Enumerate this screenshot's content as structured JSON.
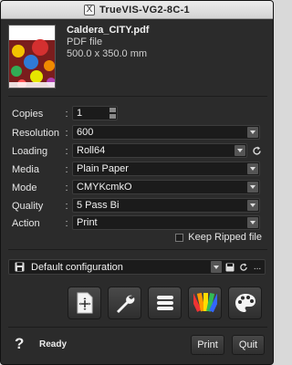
{
  "window": {
    "title": "TrueVIS-VG2-8C-1"
  },
  "file": {
    "name": "Caldera_CITY.pdf",
    "type": "PDF file",
    "size": "500.0 x 350.0 mm"
  },
  "settings": {
    "copies": {
      "label": "Copies",
      "value": "1"
    },
    "resolution": {
      "label": "Resolution",
      "value": "600"
    },
    "loading": {
      "label": "Loading",
      "value": "Roll64"
    },
    "media": {
      "label": "Media",
      "value": "Plain Paper"
    },
    "mode": {
      "label": "Mode",
      "value": "CMYKcmkO"
    },
    "quality": {
      "label": "Quality",
      "value": "5 Pass Bi"
    },
    "action": {
      "label": "Action",
      "value": "Print"
    },
    "colon": ":"
  },
  "keep_ripped": {
    "label": "Keep Ripped file",
    "checked": false
  },
  "configuration": {
    "value": "Default configuration",
    "more": "..."
  },
  "toolbar_icons": [
    "add-page-icon",
    "wrench-icon",
    "list-icon",
    "color-swatch-icon",
    "palette-icon"
  ],
  "status": {
    "help": "?",
    "text": "Ready"
  },
  "buttons": {
    "print": "Print",
    "quit": "Quit"
  },
  "colors": {
    "background": "#2b2b2b",
    "field": "#1b1b1b",
    "text": "#e6e6e6"
  }
}
